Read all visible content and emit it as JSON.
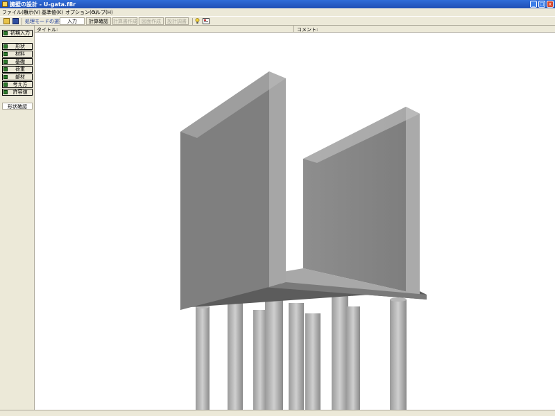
{
  "window": {
    "title": "擁壁の設計 - U-gata.f8r",
    "minimize": "_",
    "maximize": "□",
    "close": "x"
  },
  "menu": [
    "ファイル(F)",
    "表示(V)",
    "基準値(K)",
    "オプション(O)",
    "ヘルプ(H)"
  ],
  "toolbar": {
    "mode_label": "処理モードの選択",
    "buttons": [
      {
        "label": "入力",
        "state": "active"
      },
      {
        "label": "計算確認",
        "state": "normal"
      },
      {
        "label": "計算書作成",
        "state": "disabled"
      },
      {
        "label": "図面作成",
        "state": "disabled"
      },
      {
        "label": "設計調書",
        "state": "disabled"
      }
    ]
  },
  "info": {
    "title_label": "タイトル:",
    "comment_label": "コメント:"
  },
  "sidebar": {
    "initial": "初期入力",
    "items": [
      "形状",
      "材料",
      "基礎",
      "荷重",
      "部材",
      "考え方",
      "許容値"
    ],
    "confirm": "形状確認"
  },
  "colors": {
    "titlebar": "#245edb",
    "checkbox": "#2b7a2b",
    "face": "#ece9d8"
  }
}
